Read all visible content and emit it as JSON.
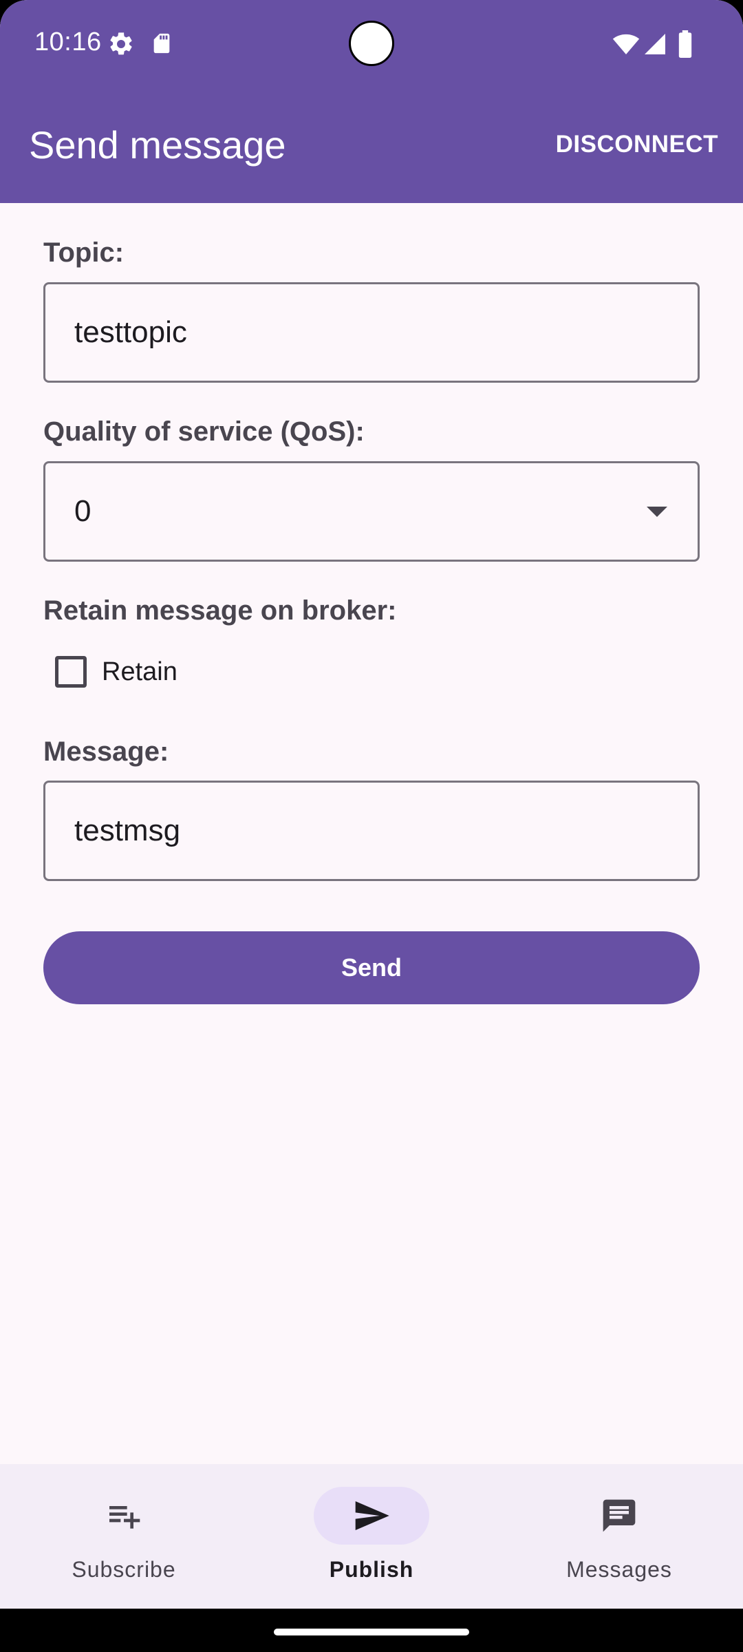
{
  "status_bar": {
    "time": "10:16",
    "icons_left": [
      "settings-icon",
      "sd-card-icon"
    ],
    "icons_right": [
      "wifi-icon",
      "signal-icon",
      "battery-icon"
    ]
  },
  "app_bar": {
    "title": "Send message",
    "action": "DISCONNECT"
  },
  "form": {
    "topic_label": "Topic:",
    "topic_value": "testtopic",
    "qos_label": "Quality of service (QoS):",
    "qos_value": "0",
    "retain_section_label": "Retain message on broker:",
    "retain_checkbox_label": "Retain",
    "retain_checked": false,
    "message_label": "Message:",
    "message_value": "testmsg",
    "send_label": "Send"
  },
  "bottom_nav": {
    "items": [
      {
        "label": "Subscribe",
        "icon": "playlist-add-icon",
        "active": false
      },
      {
        "label": "Publish",
        "icon": "send-icon",
        "active": true
      },
      {
        "label": "Messages",
        "icon": "message-icon",
        "active": false
      }
    ]
  },
  "colors": {
    "primary": "#6750a4",
    "background": "#fdf7fb",
    "nav_background": "#f3edf7",
    "active_pill": "#e8def8"
  }
}
